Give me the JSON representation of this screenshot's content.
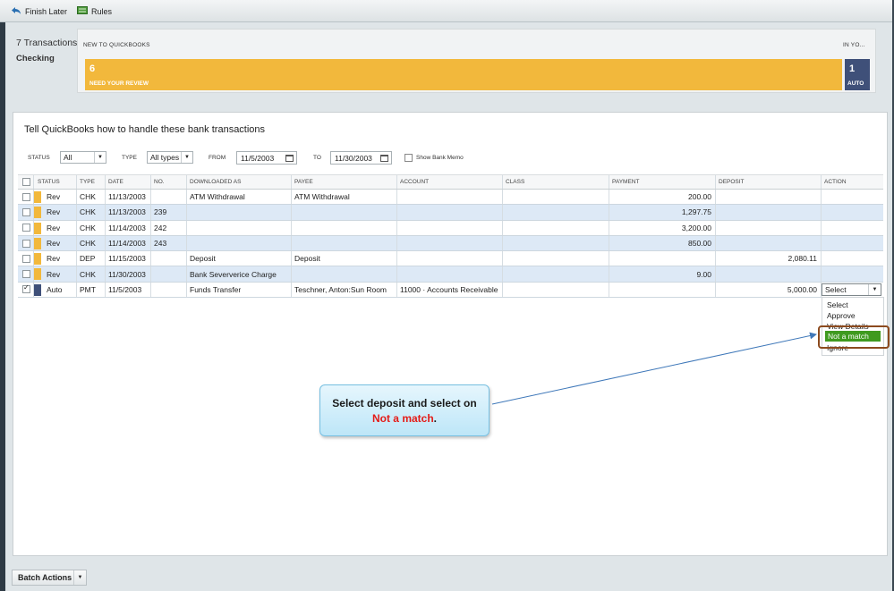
{
  "toolbar": {
    "finish_later": "Finish Later",
    "rules": "Rules"
  },
  "header": {
    "transaction_count": "7 Transactions",
    "account": "Checking",
    "new_label": "NEW TO QUICKBOOKS",
    "in_label": "IN YO...",
    "review_count": "6",
    "review_caption": "NEED YOUR REVIEW",
    "auto_count": "1",
    "auto_caption": "AUTO"
  },
  "panel": {
    "title": "Tell QuickBooks how to handle these bank transactions"
  },
  "filters": {
    "status_label": "STATUS",
    "status_value": "All",
    "type_label": "TYPE",
    "type_value": "All types",
    "from_label": "FROM",
    "from_value": "11/5/2003",
    "to_label": "TO",
    "to_value": "11/30/2003",
    "memo_label": "Show Bank Memo"
  },
  "columns": {
    "status": "STATUS",
    "type": "TYPE",
    "date": "DATE",
    "no": "NO.",
    "downloaded_as": "DOWNLOADED AS",
    "payee": "PAYEE",
    "account": "ACCOUNT",
    "class": "CLASS",
    "payment": "PAYMENT",
    "deposit": "DEPOSIT",
    "action": "ACTION"
  },
  "rows": [
    {
      "checked": false,
      "status_color": "#f2b83c",
      "status": "Rev",
      "type": "CHK",
      "date": "11/13/2003",
      "no": "",
      "downloaded_as": "ATM Withdrawal",
      "payee": "ATM Withdrawal",
      "account": "",
      "class": "",
      "payment": "200.00",
      "deposit": ""
    },
    {
      "checked": false,
      "status_color": "#f2b83c",
      "status": "Rev",
      "type": "CHK",
      "date": "11/13/2003",
      "no": "239",
      "downloaded_as": "",
      "payee": "",
      "account": "",
      "class": "",
      "payment": "1,297.75",
      "deposit": ""
    },
    {
      "checked": false,
      "status_color": "#f2b83c",
      "status": "Rev",
      "type": "CHK",
      "date": "11/14/2003",
      "no": "242",
      "downloaded_as": "",
      "payee": "",
      "account": "",
      "class": "",
      "payment": "3,200.00",
      "deposit": ""
    },
    {
      "checked": false,
      "status_color": "#f2b83c",
      "status": "Rev",
      "type": "CHK",
      "date": "11/14/2003",
      "no": "243",
      "downloaded_as": "",
      "payee": "",
      "account": "",
      "class": "",
      "payment": "850.00",
      "deposit": ""
    },
    {
      "checked": false,
      "status_color": "#f2b83c",
      "status": "Rev",
      "type": "DEP",
      "date": "11/15/2003",
      "no": "",
      "downloaded_as": "Deposit",
      "payee": "Deposit",
      "account": "",
      "class": "",
      "payment": "",
      "deposit": "2,080.11"
    },
    {
      "checked": false,
      "status_color": "#f2b83c",
      "status": "Rev",
      "type": "CHK",
      "date": "11/30/2003",
      "no": "",
      "downloaded_as": "Bank Seververice Charge",
      "payee": "",
      "account": "",
      "class": "",
      "payment": "9.00",
      "deposit": ""
    },
    {
      "checked": true,
      "status_color": "#3f5079",
      "status": "Auto",
      "type": "PMT",
      "date": "11/5/2003",
      "no": "",
      "downloaded_as": "Funds Transfer",
      "payee": "Teschner, Anton:Sun Room",
      "account": "11000 · Accounts Receivable",
      "class": "",
      "payment": "",
      "deposit": "5,000.00",
      "action": "Select"
    }
  ],
  "action_menu": {
    "options": [
      "Select",
      "Approve",
      "View Details",
      "Not a match",
      "Ignore"
    ],
    "highlighted": "Not a match"
  },
  "callout": {
    "line1": "Select deposit and select on",
    "line2_red": "Not a match",
    "line2_tail": "."
  },
  "bottom": {
    "batch_actions": "Batch Actions"
  },
  "colors": {
    "review": "#f2b83c",
    "auto": "#3f5079",
    "highlight": "#3f9a1f",
    "ring": "#8c4a1e",
    "callout_red": "#e41b17"
  }
}
